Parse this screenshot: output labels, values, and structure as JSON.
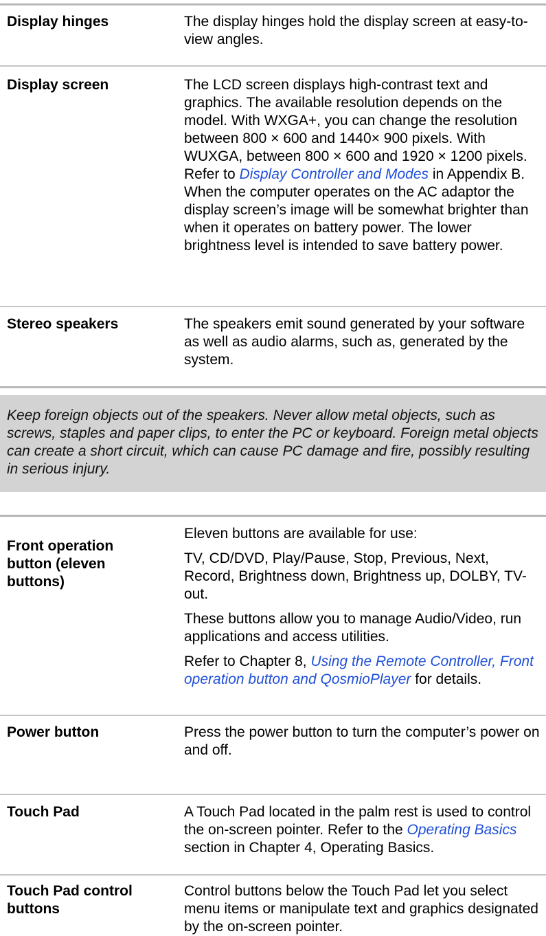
{
  "rows": [
    {
      "term": "Display hinges",
      "desc": "The display hinges hold the display screen at easy-to-view angles."
    },
    {
      "term": "Display screen",
      "desc_part1": "The LCD screen displays high-contrast text and graphics. The available resolution depends on the model. With WXGA+, you can change the resolution between 800 × 600 and 1440× 900 pixels. With WUXGA, between 800 × 600 and 1920 × 1200 pixels. Refer to ",
      "desc_link": "Display Controller and Modes",
      "desc_part2": " in Appendix B.",
      "desc_para2": "When the computer operates on the AC adaptor the display screen’s image will be somewhat brighter than when it operates on battery power. The lower brightness level is intended to save battery power."
    },
    {
      "term": "Stereo speakers",
      "desc": "The speakers emit sound generated by your software as well as audio alarms, such as, generated by the system."
    }
  ],
  "note": "Keep foreign objects out of the speakers. Never allow metal objects, such as screws, staples and paper clips, to enter the PC or keyboard. Foreign metal objects can create a short circuit, which can cause PC damage and fire, possibly resulting in serious injury.",
  "rows2": [
    {
      "term": "Front operation button (eleven buttons)",
      "p1": "Eleven buttons are available for use:",
      "p2": "TV, CD/DVD, Play/Pause, Stop, Previous, Next, Record, Brightness down, Brightness up, DOLBY, TV-out.",
      "p3": "These buttons allow you to manage Audio/Video, run applications and access utilities.",
      "p4_pre": "Refer to Chapter 8, ",
      "p4_link": "Using the Remote Controller, Front operation button and QosmioPlayer",
      "p4_post": " for details."
    },
    {
      "term": "Power button",
      "desc": "Press the power button to turn the computer’s power on and off."
    },
    {
      "term": "Touch Pad",
      "desc_pre": "A Touch Pad located in the palm rest is used to control the on-screen pointer. Refer to the ",
      "desc_link": "Operating Basics",
      "desc_post": " section in Chapter 4, Operating Basics."
    },
    {
      "term": "Touch Pad control buttons",
      "desc": "Control buttons below the Touch Pad let you select menu items or manipulate text and graphics designated by the on-screen pointer."
    }
  ]
}
